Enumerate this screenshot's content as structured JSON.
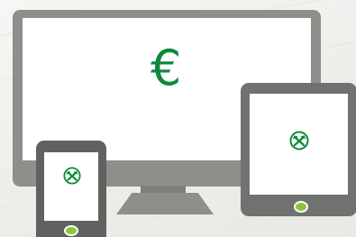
{
  "monitor": {
    "symbol": "€",
    "symbol_color": "#0b8a3a",
    "frame_color": "#8d8f8b"
  },
  "tablet": {
    "logo_icon": "raiffeisen-crossed-gables-icon",
    "button_color": "#8bc53f",
    "frame_color": "#6f726e"
  },
  "phone": {
    "logo_icon": "raiffeisen-crossed-gables-icon",
    "button_color": "#8bc53f",
    "frame_color": "#5f625e"
  }
}
